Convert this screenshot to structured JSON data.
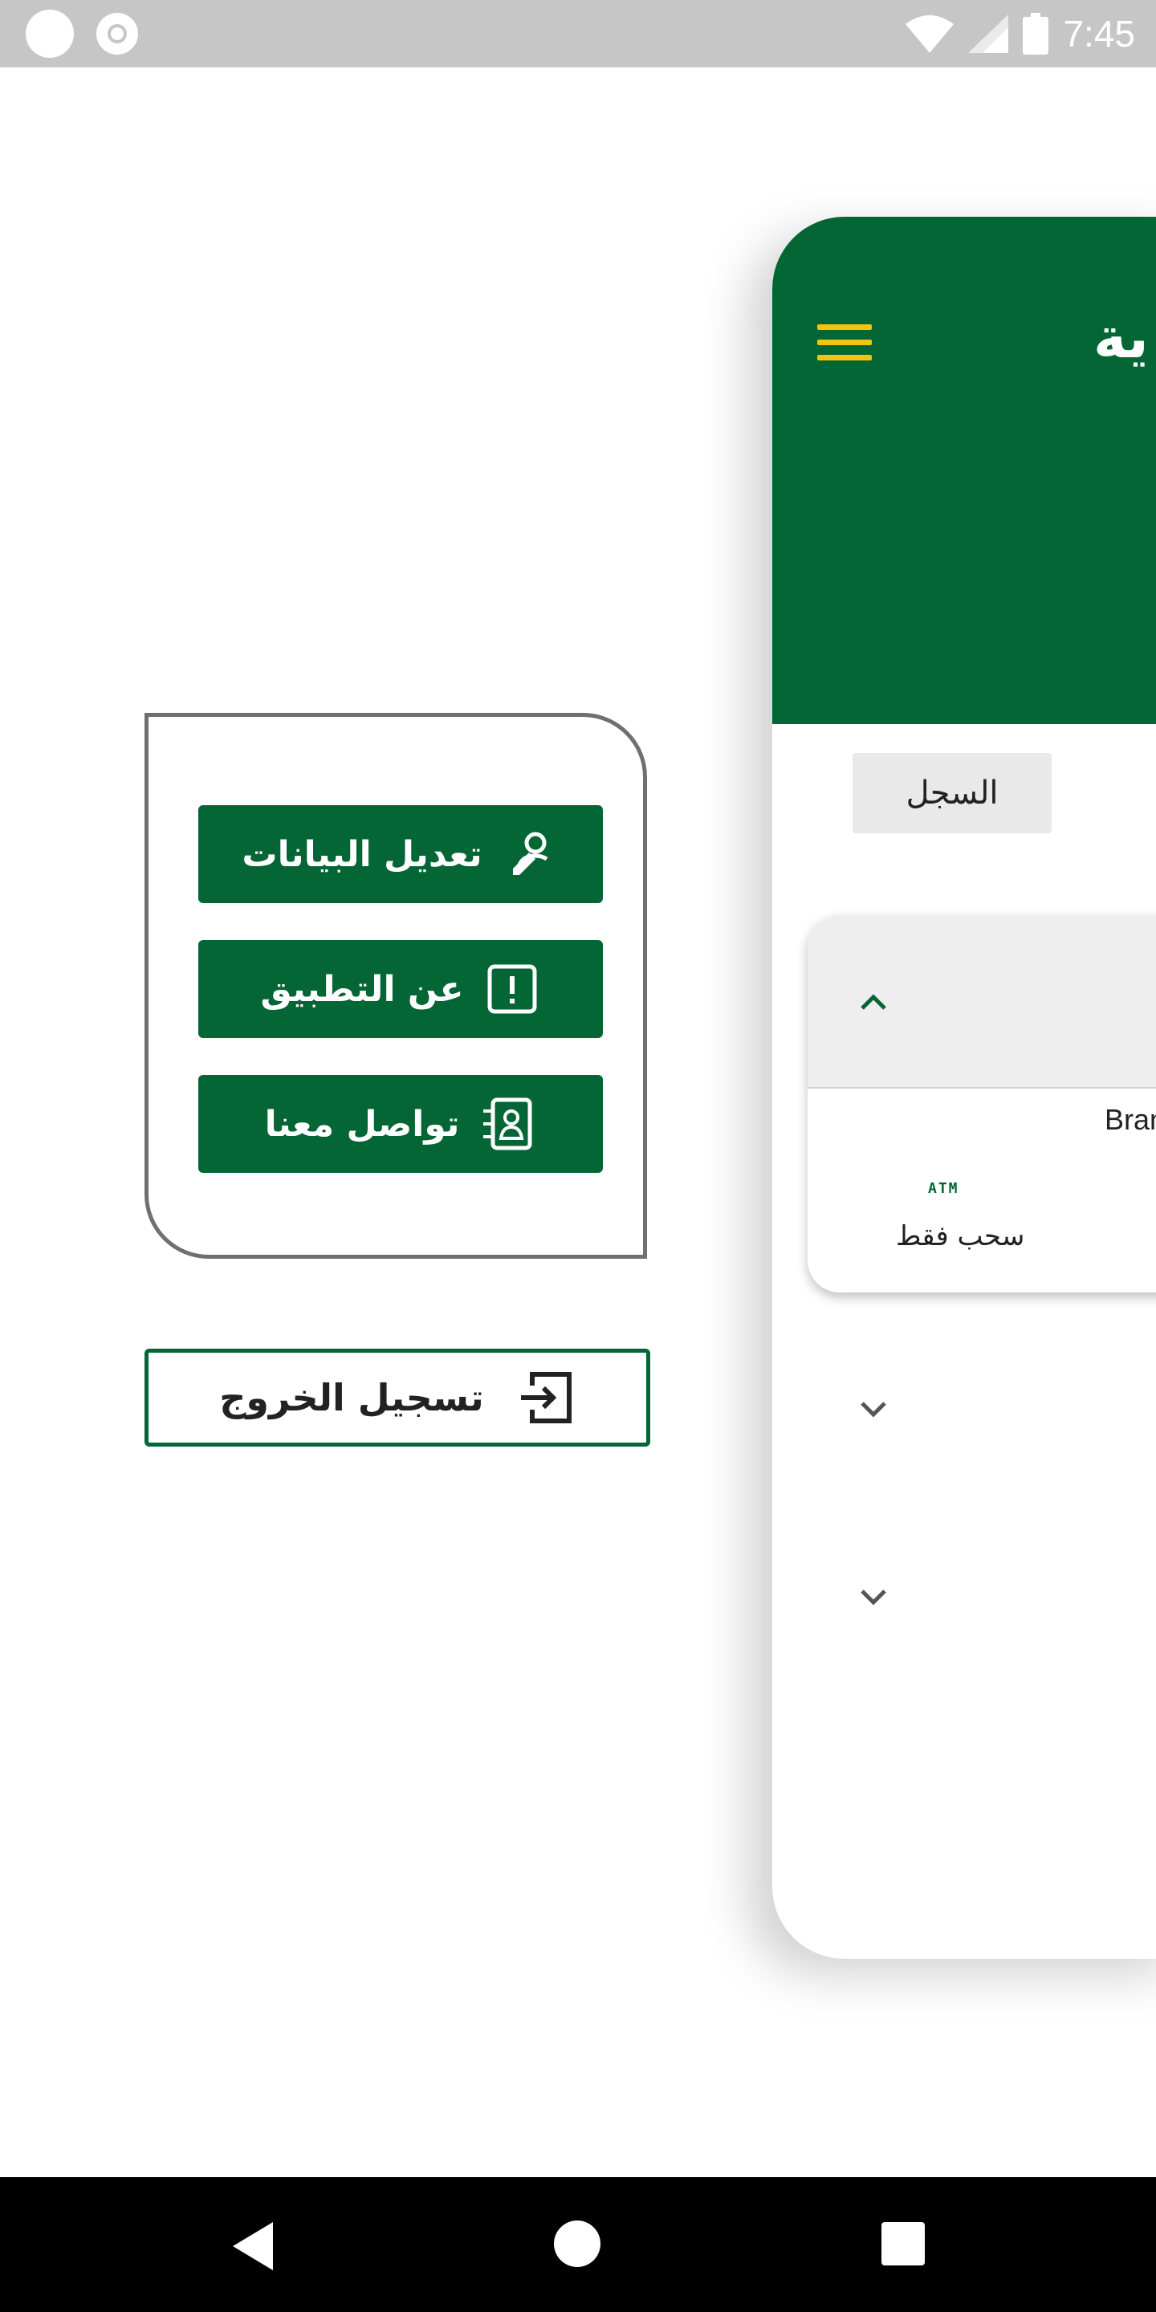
{
  "status_bar": {
    "time": "7:45"
  },
  "menu": {
    "items": [
      {
        "label": "تعديل البيانات",
        "icon": "user-edit-icon"
      },
      {
        "label": "عن التطبيق",
        "icon": "info-alert-icon"
      },
      {
        "label": "تواصل معنا",
        "icon": "contact-book-icon"
      }
    ],
    "logout_label": "تسجيل الخروج",
    "logout_icon": "logout-icon"
  },
  "main": {
    "header_title_partial": "ية",
    "history_label": "السجل",
    "accordion": {
      "branch_text": "Bran",
      "atm_text": "ATM",
      "withdraw_label": "سحب فقط"
    }
  },
  "colors": {
    "primary": "#046535",
    "accent": "#f1c40f",
    "status_bar": "#c6c6c6",
    "menu_border": "#707070"
  }
}
